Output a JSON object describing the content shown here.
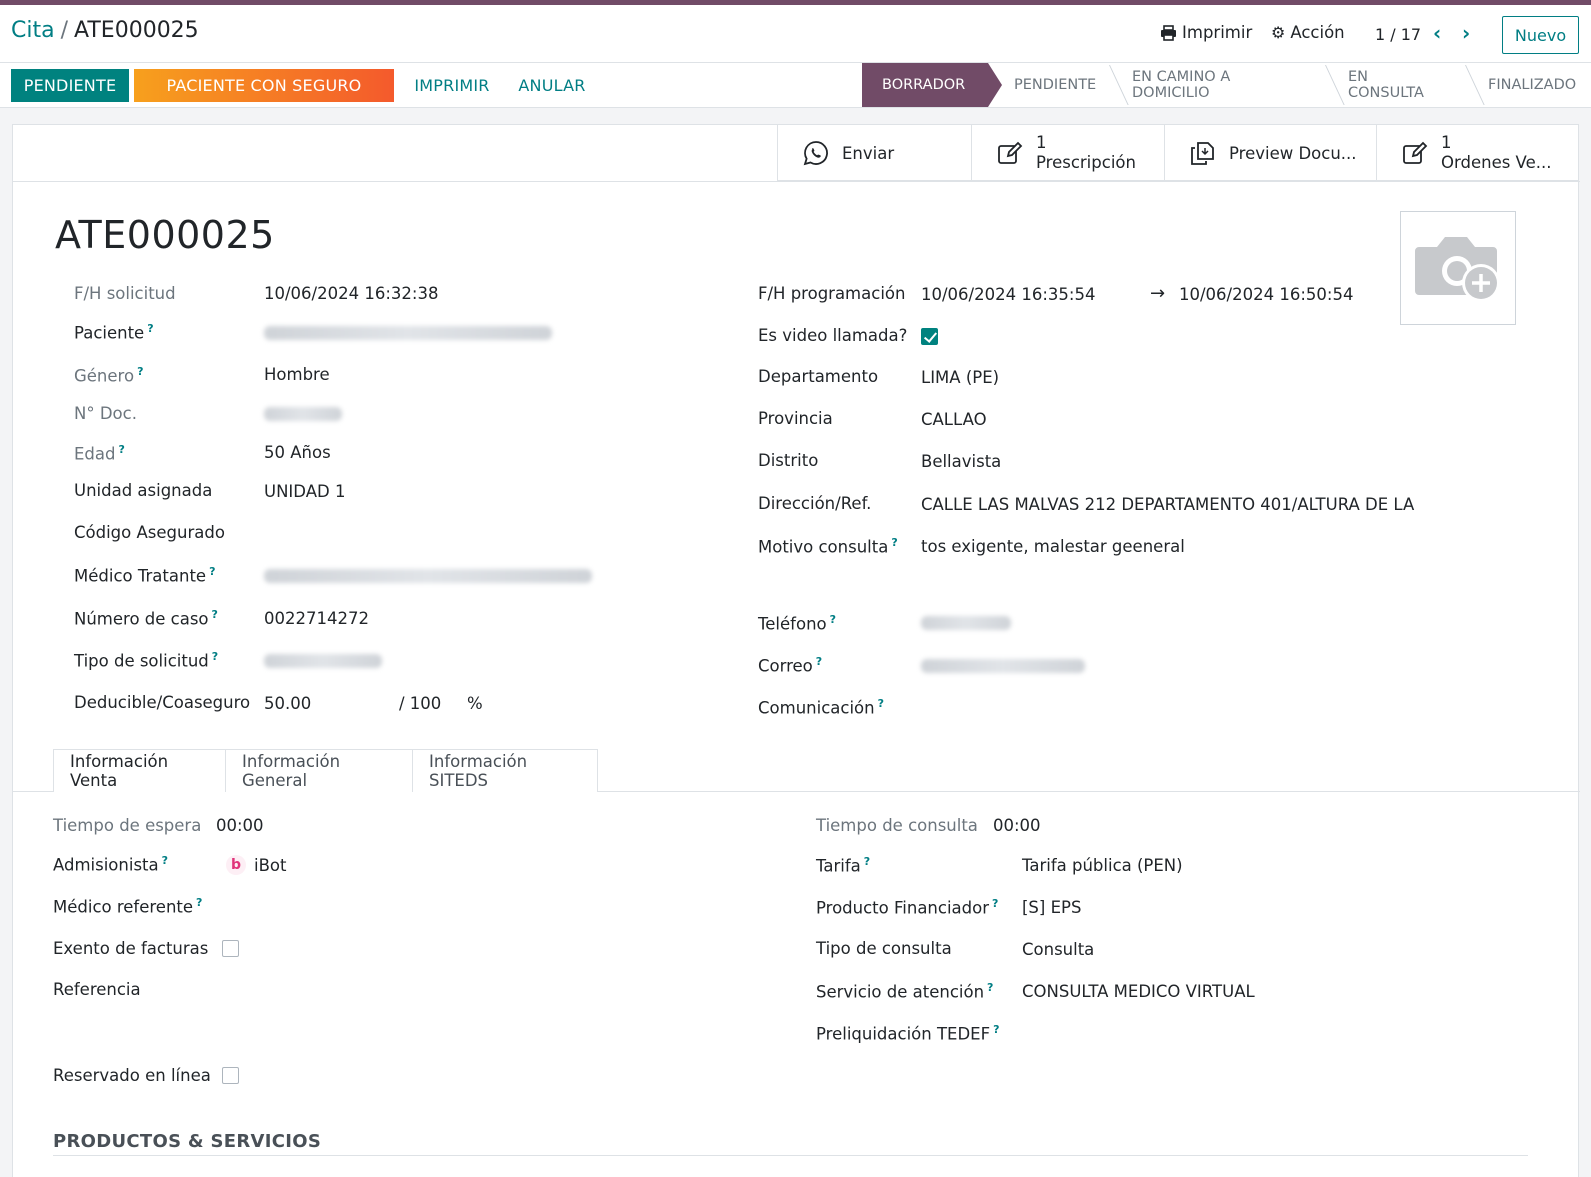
{
  "breadcrumb": {
    "parent": "Cita",
    "current": "ATE000025"
  },
  "control": {
    "print": "Imprimir",
    "action": "Acción",
    "pager": "1 / 17",
    "new": "Nuevo"
  },
  "statusbar": {
    "buttons": [
      "PENDIENTE",
      "PACIENTE CON SEGURO",
      "IMPRIMIR",
      "ANULAR"
    ],
    "stages": [
      "BORRADOR",
      "PENDIENTE",
      "EN CAMINO A DOMICILIO",
      "EN CONSULTA",
      "FINALIZADO"
    ],
    "active_stage": "BORRADOR"
  },
  "smart_buttons": {
    "enviar": "Enviar",
    "prescripcion": {
      "count": "1",
      "label": "Prescripción"
    },
    "preview": "Preview Docu...",
    "ordenes": {
      "count": "1",
      "label": "Ordenes Ve..."
    }
  },
  "record": {
    "name": "ATE000025"
  },
  "left": {
    "fh_solicitud": {
      "label": "F/H solicitud",
      "value": "10/06/2024 16:32:38"
    },
    "paciente": {
      "label": "Paciente"
    },
    "genero": {
      "label": "Género",
      "value": "Hombre"
    },
    "ndoc": {
      "label": "N° Doc."
    },
    "edad": {
      "label": "Edad",
      "value": "50 Años"
    },
    "unidad": {
      "label": "Unidad asignada",
      "value": "UNIDAD 1"
    },
    "codigo": {
      "label": "Código Asegurado"
    },
    "medico": {
      "label": "Médico Tratante"
    },
    "caso": {
      "label": "Número de caso",
      "value": "0022714272"
    },
    "tipo_sol": {
      "label": "Tipo de solicitud"
    },
    "deducible": {
      "label": "Deducible/Coaseguro",
      "value": "50.00",
      "of": "/ 100",
      "pct": "%"
    }
  },
  "right": {
    "fh_prog": {
      "label": "F/H programación",
      "start": "10/06/2024 16:35:54",
      "end": "10/06/2024 16:50:54"
    },
    "video": {
      "label": "Es video llamada?",
      "checked": true
    },
    "departamento": {
      "label": "Departamento",
      "value": "LIMA (PE)"
    },
    "provincia": {
      "label": "Provincia",
      "value": "CALLAO"
    },
    "distrito": {
      "label": "Distrito",
      "value": "Bellavista"
    },
    "direccion": {
      "label": "Dirección/Ref.",
      "value": "CALLE LAS MALVAS 212 DEPARTAMENTO 401/ALTURA DE LA"
    },
    "motivo": {
      "label": "Motivo consulta",
      "value": "tos exigente, malestar geeneral"
    },
    "telefono": {
      "label": "Teléfono"
    },
    "correo": {
      "label": "Correo"
    },
    "comunicacion": {
      "label": "Comunicación"
    }
  },
  "tabs": [
    "Información Venta",
    "Información General",
    "Información SITEDS"
  ],
  "venta": {
    "espera": {
      "label": "Tiempo de espera",
      "value": "00:00"
    },
    "admisionista": {
      "label": "Admisionista",
      "value": "iBot"
    },
    "referente": {
      "label": "Médico referente"
    },
    "exento": {
      "label": "Exento de facturas"
    },
    "referencia": {
      "label": "Referencia"
    },
    "reservado": {
      "label": "Reservado en línea"
    },
    "consulta": {
      "label": "Tiempo de consulta",
      "value": "00:00"
    },
    "tarifa": {
      "label": "Tarifa",
      "value": "Tarifa pública (PEN)"
    },
    "producto": {
      "label": "Producto Financiador",
      "value": "[S] EPS"
    },
    "tipo_consulta": {
      "label": "Tipo de consulta",
      "value": "Consulta"
    },
    "servicio": {
      "label": "Servicio de atención",
      "value": "CONSULTA MEDICO VIRTUAL"
    },
    "preliq": {
      "label": "Preliquidación TEDEF"
    }
  },
  "section": {
    "productos": "PRODUCTOS & SERVICIOS"
  },
  "help_mark": "?",
  "colors": {
    "brand": "#714b67",
    "primary": "#017e84",
    "status_btn": "#00827f",
    "seguro_start": "#f7a01d",
    "seguro_end": "#f45a2c"
  }
}
